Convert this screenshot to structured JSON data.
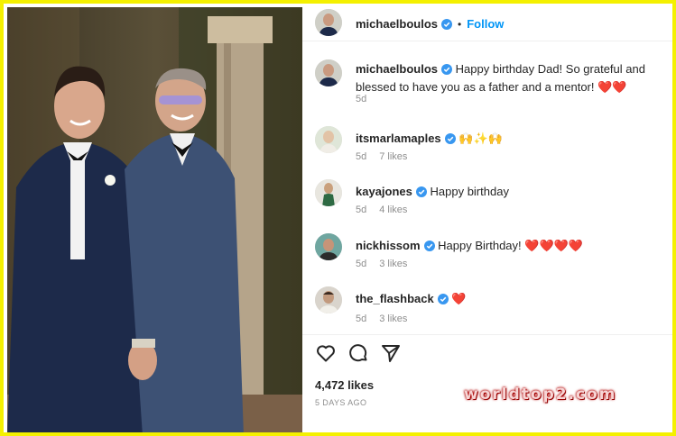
{
  "post": {
    "author": "michaelboulos",
    "follow_label": "Follow",
    "separator": "•",
    "caption": "Happy birthday Dad! So grateful and blessed to have you as a father and a mentor!",
    "caption_emoji": "❤️❤️",
    "caption_time": "5d",
    "likes": "4,472 likes",
    "posted_ago": "5 DAYS AGO"
  },
  "comments": [
    {
      "user": "itsmarlamaples",
      "text": "",
      "emoji": "🙌✨🙌",
      "time": "5d",
      "likes": "7 likes"
    },
    {
      "user": "kayajones",
      "text": "Happy birthday",
      "emoji": "",
      "time": "5d",
      "likes": "4 likes"
    },
    {
      "user": "nickhissom",
      "text": "Happy Birthday!",
      "emoji": "❤️❤️❤️❤️",
      "time": "5d",
      "likes": "3 likes"
    },
    {
      "user": "the_flashback",
      "text": "",
      "emoji": "❤️",
      "time": "5d",
      "likes": "3 likes"
    }
  ],
  "watermark": "worldtop2.com",
  "colors": {
    "accent": "#0095f6",
    "verified": "#3897f0",
    "frame": "#f4f000",
    "heart": "#e0002a"
  },
  "icons": [
    "verified-badge-icon",
    "heart-icon",
    "comment-icon",
    "share-icon"
  ]
}
